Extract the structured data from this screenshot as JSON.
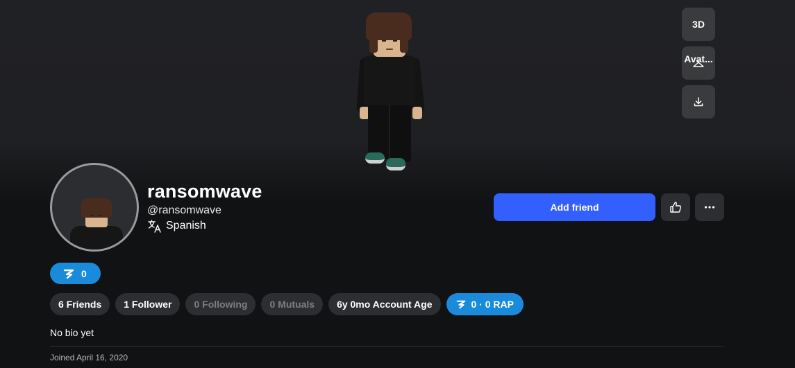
{
  "viewer": {
    "buttons": {
      "mode_3d": "3D",
      "avatar": "Avat...",
      "download_icon": "download-icon"
    }
  },
  "profile": {
    "display_name": "ransomwave",
    "handle": "@ransomwave",
    "language": "Spanish",
    "language_icon": "translate-icon"
  },
  "actions": {
    "add_friend": "Add friend",
    "like_icon": "thumbs-up-icon",
    "more_icon": "more-dots-icon"
  },
  "currency": {
    "robux": "0"
  },
  "stats": {
    "friends": "6 Friends",
    "followers": "1 Follower",
    "following": "0 Following",
    "mutuals": "0 Mutuals",
    "account_age": "6y 0mo Account Age",
    "rap": "0 · 0 RAP"
  },
  "bio": "No bio yet",
  "joined": "Joined April 16, 2020",
  "colors": {
    "background": "#111214",
    "primary_button": "#335fff",
    "currency_pill": "#1a8bdb",
    "pill": "#2c2e32"
  }
}
